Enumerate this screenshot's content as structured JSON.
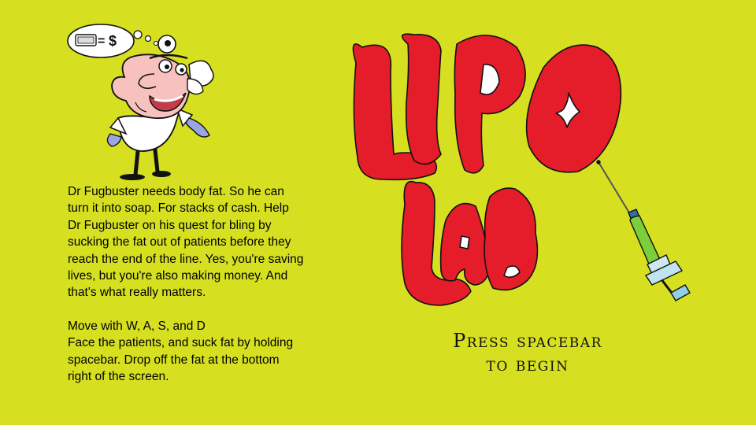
{
  "title": {
    "line1": "LIPO",
    "line2": "LAB",
    "color": "#e51c2a"
  },
  "background_color": "#d6e021",
  "thought_bubble": {
    "money_label": "$",
    "equals": "=",
    "dollar": "$"
  },
  "story": {
    "intro": "Dr Fugbuster needs  body fat. So he can turn it into soap. For stacks of cash. Help Dr Fugbuster on his quest for bling by sucking the fat out of patients before they reach the end of the line. Yes, you're saving lives, but you're also making money. And that's what really matters.",
    "controls_line1": "Move with W, A, S, and D",
    "controls_line2": "Face the patients, and suck fat by holding spacebar. Drop off the fat at the bottom right of the screen."
  },
  "prompt": {
    "line1": "Press spacebar",
    "line2": "to begin"
  },
  "icons": {
    "character": "doctor-character",
    "syringe": "syringe-icon",
    "thought": "thought-bubble-icon"
  }
}
